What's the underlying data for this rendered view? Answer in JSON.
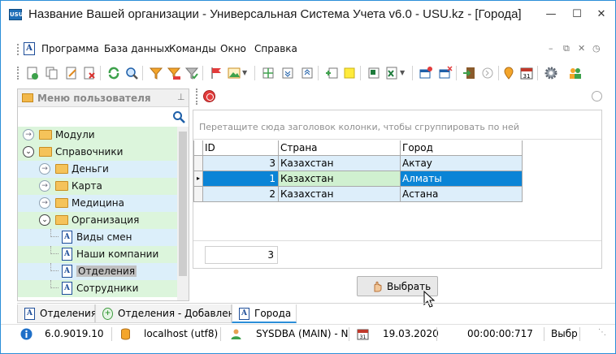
{
  "window": {
    "title": "Название Вашей организации - Универсальная Система Учета v6.0 - USU.kz - [Города]",
    "icon_label": "USU",
    "controls": [
      "minimize-icon",
      "maximize-icon",
      "close-icon"
    ]
  },
  "menu": {
    "items": [
      "Программа",
      "База данных",
      "Команды",
      "Окно",
      "Справка"
    ],
    "doc_icon_letter": "A"
  },
  "toolbar": {
    "icons": [
      "new-record-icon",
      "copy-icon",
      "edit-icon",
      "delete-icon",
      "refresh-icon",
      "search-icon",
      "filter-icon",
      "filter-clear-icon",
      "filter-settings-icon",
      "flag-icon",
      "image-icon",
      "columns-icon",
      "collapse-icon",
      "expand-icon",
      "add-row-icon",
      "note-icon",
      "export-excel-icon",
      "excel-icon",
      "new-window-icon",
      "close-window-icon",
      "exit-icon",
      "forward-icon",
      "location-icon",
      "calendar-icon",
      "settings-icon",
      "users-icon"
    ]
  },
  "sidebar": {
    "title": "Меню пользователя",
    "tree": [
      {
        "label": "Модули",
        "level": 0,
        "kind": "folder",
        "expanded": false,
        "bg": "green"
      },
      {
        "label": "Справочники",
        "level": 0,
        "kind": "folder",
        "expanded": true,
        "bg": "green"
      },
      {
        "label": "Деньги",
        "level": 1,
        "kind": "folder",
        "expanded": false,
        "bg": "blue"
      },
      {
        "label": "Карта",
        "level": 1,
        "kind": "folder",
        "expanded": false,
        "bg": "green"
      },
      {
        "label": "Медицина",
        "level": 1,
        "kind": "folder",
        "expanded": false,
        "bg": "blue"
      },
      {
        "label": "Организация",
        "level": 1,
        "kind": "folder",
        "expanded": true,
        "bg": "green"
      },
      {
        "label": "Виды смен",
        "level": 2,
        "kind": "doc",
        "bg": "blue"
      },
      {
        "label": "Наши компании",
        "level": 2,
        "kind": "doc",
        "bg": "green"
      },
      {
        "label": "Отделения",
        "level": 2,
        "kind": "doc",
        "bg": "blue",
        "selected": true
      },
      {
        "label": "Сотрудники",
        "level": 2,
        "kind": "doc",
        "bg": "green"
      }
    ]
  },
  "grid": {
    "group_hint": "Перетащите сюда заголовок колонки, чтобы сгруппировать по ней",
    "columns": [
      "ID",
      "Страна",
      "Город"
    ],
    "rows": [
      {
        "id": "3",
        "country": "Казахстан",
        "city": "Актау"
      },
      {
        "id": "1",
        "country": "Казахстан",
        "city": "Алматы",
        "current": true
      },
      {
        "id": "2",
        "country": "Казахстан",
        "city": "Астана"
      }
    ],
    "row_count": "3"
  },
  "select_button": {
    "label": "Выбрать"
  },
  "tabs": [
    {
      "label": "Отделения",
      "icon": "A"
    },
    {
      "label": "Отделения - Добавление",
      "icon": "+"
    },
    {
      "label": "Города",
      "icon": "A",
      "active": true
    }
  ],
  "status": {
    "version": "6.0.9019.10",
    "database": "localhost (utf8)",
    "user": "SYSDBA (MAIN) - N",
    "date": "19.03.2020",
    "timer": "00:00:00:717",
    "action": "Выбра"
  },
  "colors": {
    "accent": "#2b8ed8",
    "selected_row": "#0a84d6",
    "alt_row": "#ddeefa",
    "tree_green": "#dcf5dc",
    "tree_blue": "#dceffa"
  }
}
